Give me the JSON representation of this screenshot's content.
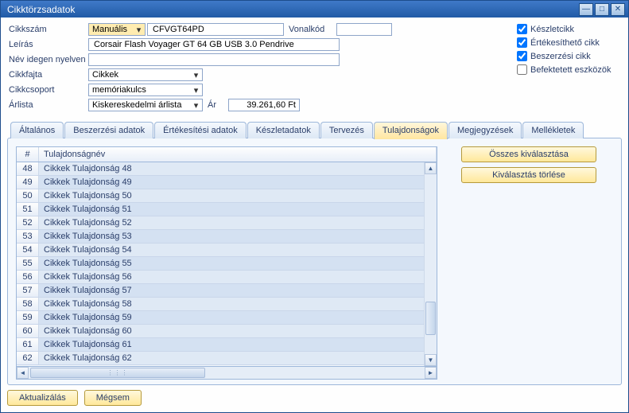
{
  "window": {
    "title": "Cikktörzsadatok"
  },
  "form": {
    "cikkszam_label": "Cikkszám",
    "cikkszam_mode": "Manuális",
    "cikkszam_value": "CFVGT64PD",
    "vonalkod_label": "Vonalkód",
    "vonalkod_value": "",
    "leiras_label": "Leírás",
    "leiras_value": "Corsair Flash Voyager GT 64 GB USB 3.0 Pendrive",
    "idegen_label": "Név idegen nyelven",
    "idegen_value": "",
    "cikkfajta_label": "Cikkfajta",
    "cikkfajta_value": "Cikkek",
    "cikkcsoport_label": "Cikkcsoport",
    "cikkcsoport_value": "memóriakulcs",
    "arlista_label": "Árlista",
    "arlista_value": "Kiskereskedelmi árlista",
    "ar_label": "Ár",
    "ar_value": "39.261,60 Ft"
  },
  "checks": {
    "keszlet": "Készletcikk",
    "ertek": "Értékesíthető cikk",
    "beszer": "Beszerzési cikk",
    "befekt": "Befektetett eszközök"
  },
  "tabs": [
    "Általános",
    "Beszerzési adatok",
    "Értékesítési adatok",
    "Készletadatok",
    "Tervezés",
    "Tulajdonságok",
    "Megjegyzések",
    "Mellékletek"
  ],
  "active_tab": 5,
  "grid": {
    "col_num": "#",
    "col_name": "Tulajdonságnév",
    "rows": [
      {
        "n": "48",
        "name": "Cikkek Tulajdonság 48"
      },
      {
        "n": "49",
        "name": "Cikkek Tulajdonság 49"
      },
      {
        "n": "50",
        "name": "Cikkek Tulajdonság 50"
      },
      {
        "n": "51",
        "name": "Cikkek Tulajdonság 51"
      },
      {
        "n": "52",
        "name": "Cikkek Tulajdonság 52"
      },
      {
        "n": "53",
        "name": "Cikkek Tulajdonság 53"
      },
      {
        "n": "54",
        "name": "Cikkek Tulajdonság 54"
      },
      {
        "n": "55",
        "name": "Cikkek Tulajdonság 55"
      },
      {
        "n": "56",
        "name": "Cikkek Tulajdonság 56"
      },
      {
        "n": "57",
        "name": "Cikkek Tulajdonság 57"
      },
      {
        "n": "58",
        "name": "Cikkek Tulajdonság 58"
      },
      {
        "n": "59",
        "name": "Cikkek Tulajdonság 59"
      },
      {
        "n": "60",
        "name": "Cikkek Tulajdonság 60"
      },
      {
        "n": "61",
        "name": "Cikkek Tulajdonság 61"
      },
      {
        "n": "62",
        "name": "Cikkek Tulajdonság 62"
      }
    ]
  },
  "side": {
    "select_all": "Összes kiválasztása",
    "clear_sel": "Kiválasztás törlése"
  },
  "footer": {
    "update": "Aktualizálás",
    "cancel": "Mégsem"
  }
}
